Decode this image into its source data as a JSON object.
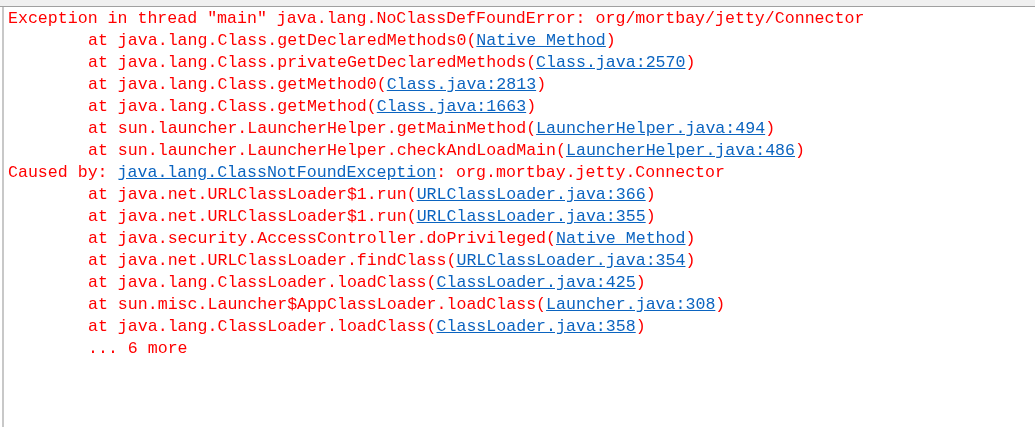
{
  "console": {
    "lines": [
      {
        "kind": "plain",
        "text": "Exception in thread \"main\" java.lang.NoClassDefFoundError: org/mortbay/jetty/Connector"
      },
      {
        "kind": "frame",
        "text": "at java.lang.Class.getDeclaredMethods0(",
        "link": "Native Method",
        "tail": ")"
      },
      {
        "kind": "frame",
        "text": "at java.lang.Class.privateGetDeclaredMethods(",
        "link": "Class.java:2570",
        "tail": ")"
      },
      {
        "kind": "frame",
        "text": "at java.lang.Class.getMethod0(",
        "link": "Class.java:2813",
        "tail": ")"
      },
      {
        "kind": "frame",
        "text": "at java.lang.Class.getMethod(",
        "link": "Class.java:1663",
        "tail": ")"
      },
      {
        "kind": "frame",
        "text": "at sun.launcher.LauncherHelper.getMainMethod(",
        "link": "LauncherHelper.java:494",
        "tail": ")"
      },
      {
        "kind": "frame",
        "text": "at sun.launcher.LauncherHelper.checkAndLoadMain(",
        "link": "LauncherHelper.java:486",
        "tail": ")"
      },
      {
        "kind": "plain",
        "text": "Caused by: ",
        "link": "java.lang.ClassNotFoundException",
        "tail": ": org.mortbay.jetty.Connector"
      },
      {
        "kind": "frame",
        "text": "at java.net.URLClassLoader$1.run(",
        "link": "URLClassLoader.java:366",
        "tail": ")"
      },
      {
        "kind": "frame",
        "text": "at java.net.URLClassLoader$1.run(",
        "link": "URLClassLoader.java:355",
        "tail": ")"
      },
      {
        "kind": "frame",
        "text": "at java.security.AccessController.doPrivileged(",
        "link": "Native Method",
        "tail": ")"
      },
      {
        "kind": "frame",
        "text": "at java.net.URLClassLoader.findClass(",
        "link": "URLClassLoader.java:354",
        "tail": ")"
      },
      {
        "kind": "frame",
        "text": "at java.lang.ClassLoader.loadClass(",
        "link": "ClassLoader.java:425",
        "tail": ")"
      },
      {
        "kind": "frame",
        "text": "at sun.misc.Launcher$AppClassLoader.loadClass(",
        "link": "Launcher.java:308",
        "tail": ")"
      },
      {
        "kind": "frame",
        "text": "at java.lang.ClassLoader.loadClass(",
        "link": "ClassLoader.java:358",
        "tail": ")"
      },
      {
        "kind": "frame",
        "text": "... 6 more"
      }
    ]
  }
}
